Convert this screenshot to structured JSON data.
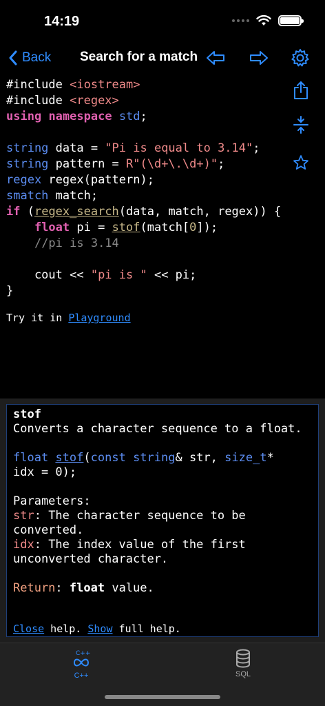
{
  "status": {
    "time": "14:19"
  },
  "nav": {
    "back_label": "Back",
    "title": "Search for a match"
  },
  "code_lines": [
    [
      {
        "t": "#include ",
        "c": "pl"
      },
      {
        "t": "<iostream>",
        "c": "inc"
      }
    ],
    [
      {
        "t": "#include ",
        "c": "pl"
      },
      {
        "t": "<regex>",
        "c": "inc"
      }
    ],
    [
      {
        "t": "using",
        "c": "kw"
      },
      {
        "t": " ",
        "c": "pl"
      },
      {
        "t": "namespace",
        "c": "kw"
      },
      {
        "t": " ",
        "c": "pl"
      },
      {
        "t": "std",
        "c": "ty"
      },
      {
        "t": ";",
        "c": "pl"
      }
    ],
    [
      {
        "t": "",
        "c": "pl"
      }
    ],
    [
      {
        "t": "string",
        "c": "ty"
      },
      {
        "t": " data = ",
        "c": "pl"
      },
      {
        "t": "\"Pi is equal to 3.14\"",
        "c": "str"
      },
      {
        "t": ";",
        "c": "pl"
      }
    ],
    [
      {
        "t": "string",
        "c": "ty"
      },
      {
        "t": " pattern = ",
        "c": "pl"
      },
      {
        "t": "R\"(\\d+\\.\\d+)\"",
        "c": "str"
      },
      {
        "t": ";",
        "c": "pl"
      }
    ],
    [
      {
        "t": "regex",
        "c": "ty"
      },
      {
        "t": " regex(pattern);",
        "c": "pl"
      }
    ],
    [
      {
        "t": "smatch",
        "c": "ty"
      },
      {
        "t": " match;",
        "c": "pl"
      }
    ],
    [
      {
        "t": "if",
        "c": "kw"
      },
      {
        "t": " (",
        "c": "pl"
      },
      {
        "t": "regex_search",
        "c": "fn"
      },
      {
        "t": "(data, match, regex)) {",
        "c": "pl"
      }
    ],
    [
      {
        "t": "    ",
        "c": "pl"
      },
      {
        "t": "float",
        "c": "kw"
      },
      {
        "t": " pi = ",
        "c": "pl"
      },
      {
        "t": "stof",
        "c": "fn"
      },
      {
        "t": "(match[",
        "c": "pl"
      },
      {
        "t": "0",
        "c": "num"
      },
      {
        "t": "]);",
        "c": "pl"
      }
    ],
    [
      {
        "t": "    ",
        "c": "pl"
      },
      {
        "t": "//pi is 3.14",
        "c": "cm"
      }
    ],
    [
      {
        "t": "",
        "c": "pl"
      }
    ],
    [
      {
        "t": "    cout << ",
        "c": "pl"
      },
      {
        "t": "\"pi is \"",
        "c": "str"
      },
      {
        "t": " << pi;",
        "c": "pl"
      }
    ],
    [
      {
        "t": "}",
        "c": "pl"
      }
    ]
  ],
  "try_it": {
    "prefix": "Try it in ",
    "link": "Playground"
  },
  "help": {
    "name": "stof",
    "description": "Converts a character sequence to a float.",
    "signature": [
      {
        "t": "float",
        "c": "ty"
      },
      {
        "t": " ",
        "c": "pl"
      },
      {
        "t": "stof",
        "c": "fnlink"
      },
      {
        "t": "(",
        "c": "pl"
      },
      {
        "t": "const",
        "c": "ty"
      },
      {
        "t": " ",
        "c": "pl"
      },
      {
        "t": "string",
        "c": "ty"
      },
      {
        "t": "& str, ",
        "c": "pl"
      },
      {
        "t": "size_t",
        "c": "ty"
      },
      {
        "t": "*\nidx = 0);",
        "c": "pl"
      }
    ],
    "params_heading": "Parameters:",
    "params": [
      {
        "name": "str",
        "desc": ": The character sequence to be converted."
      },
      {
        "name": "idx",
        "desc": ": The index value of the first unconverted character."
      }
    ],
    "return_label": "Return",
    "return_colon": ": ",
    "return_type": "float",
    "return_rest": " value.",
    "close_link": "Close",
    "help_text": " help. ",
    "show_link": "Show",
    "full_help_text": " full help."
  },
  "tabs": [
    {
      "label": "C++",
      "icon": "cpp-infinity-icon",
      "active": true
    },
    {
      "label": "SQL",
      "icon": "database-icon",
      "active": false
    }
  ],
  "colors": {
    "accent": "#2f8cff",
    "keyword": "#e060b0",
    "type": "#5b8cf0",
    "string": "#f08a8a"
  }
}
